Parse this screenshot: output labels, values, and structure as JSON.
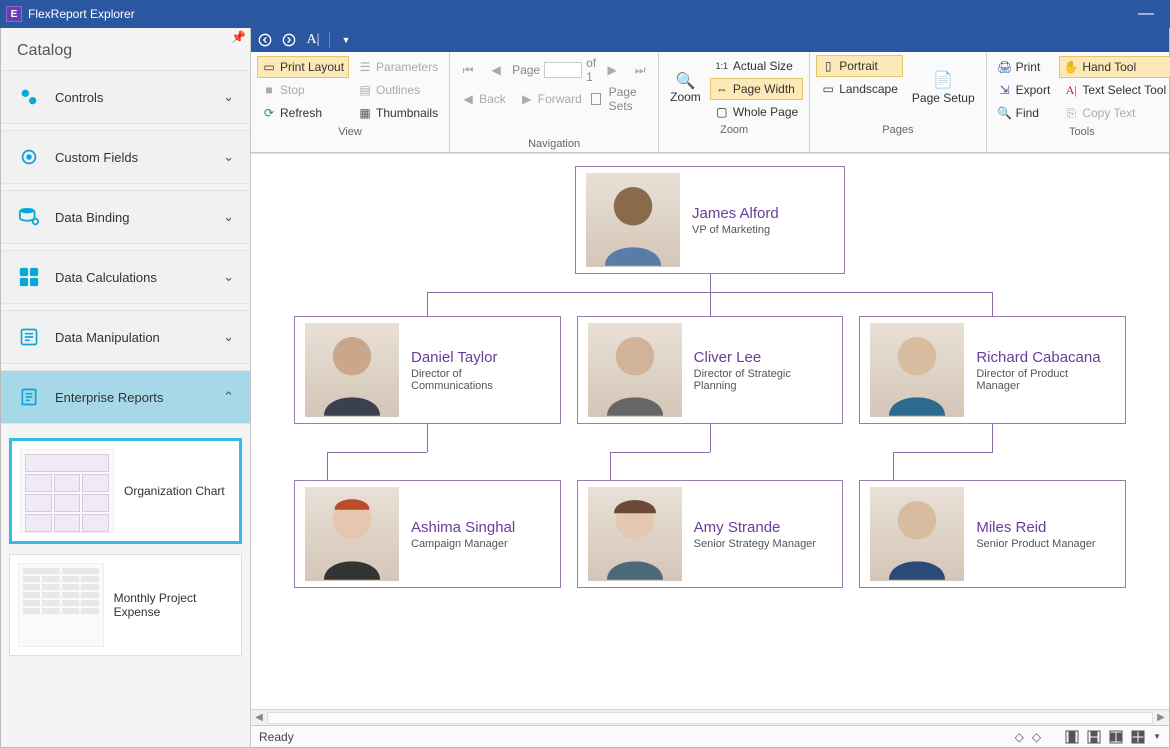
{
  "app": {
    "title": "FlexReport Explorer"
  },
  "sidebar": {
    "heading": "Catalog",
    "items": [
      {
        "label": "Controls"
      },
      {
        "label": "Custom Fields"
      },
      {
        "label": "Data Binding"
      },
      {
        "label": "Data Calculations"
      },
      {
        "label": "Data Manipulation"
      },
      {
        "label": "Enterprise Reports"
      }
    ],
    "thumbs": [
      {
        "label": "Organization Chart"
      },
      {
        "label": "Monthly Project Expense"
      }
    ]
  },
  "ribbon": {
    "view": {
      "print_layout": "Print Layout",
      "stop": "Stop",
      "refresh": "Refresh",
      "parameters": "Parameters",
      "outlines": "Outlines",
      "thumbnails": "Thumbnails",
      "group": "View"
    },
    "nav": {
      "page": "Page",
      "of": "of 1",
      "back": "Back",
      "forward": "Forward",
      "page_sets": "Page Sets",
      "group": "Navigation"
    },
    "zoom": {
      "zoom": "Zoom",
      "actual": "Actual Size",
      "page_width": "Page Width",
      "whole": "Whole Page",
      "group": "Zoom"
    },
    "pages": {
      "portrait": "Portrait",
      "landscape": "Landscape",
      "setup": "Page Setup",
      "group": "Pages"
    },
    "tools": {
      "print": "Print",
      "export": "Export",
      "find": "Find",
      "hand": "Hand Tool",
      "text_select": "Text Select Tool",
      "copy": "Copy Text",
      "group": "Tools"
    }
  },
  "org": {
    "root": {
      "name": "James Alford",
      "title": "VP of Marketing"
    },
    "mids": [
      {
        "name": "Daniel Taylor",
        "title": "Director of Communications"
      },
      {
        "name": "Cliver Lee",
        "title": "Director of Strategic Planning"
      },
      {
        "name": "Richard Cabacana",
        "title": "Director of Product Manager"
      }
    ],
    "leafs": [
      {
        "name": "Ashima Singhal",
        "title": "Campaign Manager"
      },
      {
        "name": "Amy Strande",
        "title": "Senior Strategy Manager"
      },
      {
        "name": "Miles Reid",
        "title": "Senior Product Manager"
      }
    ]
  },
  "status": {
    "text": "Ready"
  }
}
